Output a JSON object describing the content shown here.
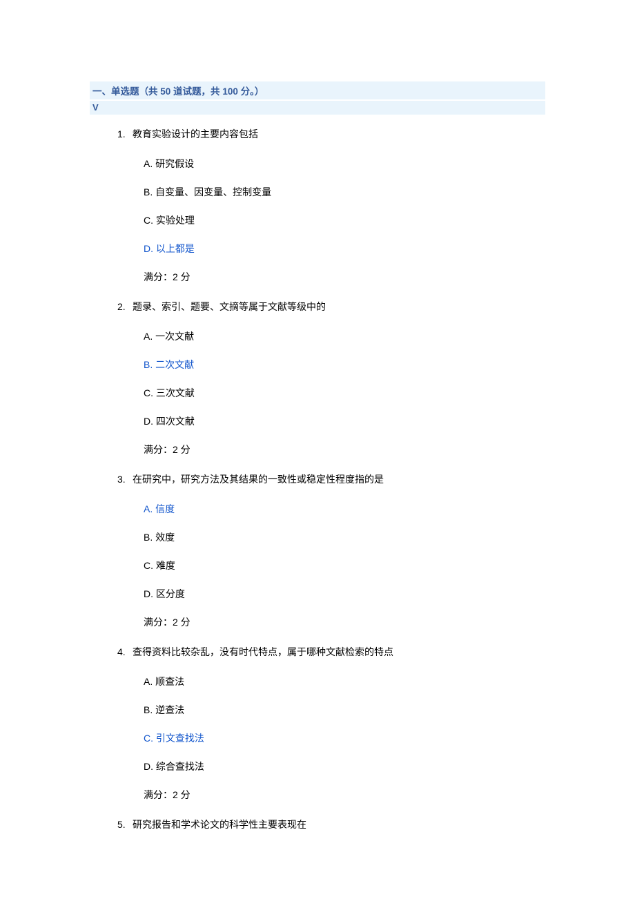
{
  "header": {
    "title_prefix": "一、单选题（共 ",
    "count": "50",
    "title_mid": " 道试题，共 ",
    "total": "100",
    "title_suffix": " 分。）",
    "check": "V"
  },
  "full_score_label": "满分：2  分",
  "questions": [
    {
      "num": "1.",
      "stem": "教育实验设计的主要内容包括",
      "options": [
        {
          "label": "A.",
          "text": "研究假设",
          "correct": false
        },
        {
          "label": "B.",
          "text": "自变量、因变量、控制变量",
          "correct": false
        },
        {
          "label": "C.",
          "text": "实验处理",
          "correct": false
        },
        {
          "label": "D.",
          "text": "以上都是",
          "correct": true
        }
      ]
    },
    {
      "num": "2.",
      "stem": "题录、索引、题要、文摘等属于文献等级中的",
      "options": [
        {
          "label": "A.",
          "text": "一次文献",
          "correct": false
        },
        {
          "label": "B.",
          "text": "二次文献",
          "correct": true
        },
        {
          "label": "C.",
          "text": "三次文献",
          "correct": false
        },
        {
          "label": "D.",
          "text": "四次文献",
          "correct": false
        }
      ]
    },
    {
      "num": "3.",
      "stem": "在研究中，研究方法及其结果的一致性或稳定性程度指的是",
      "options": [
        {
          "label": "A.",
          "text": "信度",
          "correct": true
        },
        {
          "label": "B.",
          "text": "效度",
          "correct": false
        },
        {
          "label": "C.",
          "text": "难度",
          "correct": false
        },
        {
          "label": "D.",
          "text": "区分度",
          "correct": false
        }
      ]
    },
    {
      "num": "4.",
      "stem": "查得资料比较杂乱，没有时代特点，属于哪种文献检索的特点",
      "options": [
        {
          "label": "A.",
          "text": "顺查法",
          "correct": false
        },
        {
          "label": "B.",
          "text": "逆查法",
          "correct": false
        },
        {
          "label": "C.",
          "text": "引文查找法",
          "correct": true
        },
        {
          "label": "D.",
          "text": "综合查找法",
          "correct": false
        }
      ]
    },
    {
      "num": "5.",
      "stem": "研究报告和学术论文的科学性主要表现在",
      "options": []
    }
  ]
}
